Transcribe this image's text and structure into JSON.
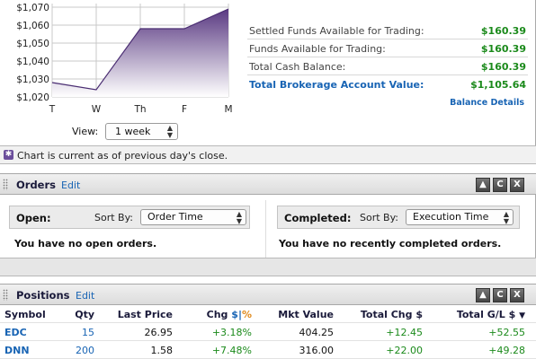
{
  "chart": {
    "y_ticks": [
      "$1,070",
      "$1,060",
      "$1,050",
      "$1,040",
      "$1,030",
      "$1,020"
    ],
    "x_ticks": [
      "T",
      "W",
      "Th",
      "F",
      "M"
    ],
    "view_label": "View:",
    "view_selected": "1 week",
    "fill_top_color": "#5a3a82",
    "fill_bottom_color": "#ffffff"
  },
  "chart_data": {
    "type": "area",
    "categories": [
      "T",
      "W",
      "Th",
      "F",
      "M"
    ],
    "values": [
      1028,
      1024,
      1058,
      1058,
      1069
    ],
    "ylim": [
      1020,
      1072
    ],
    "grid": true
  },
  "balances": {
    "rows": [
      {
        "label": "Settled Funds Available for Trading:",
        "value": "$160.39"
      },
      {
        "label": "Funds Available for Trading:",
        "value": "$160.39"
      },
      {
        "label": "Total Cash Balance:",
        "value": "$160.39"
      },
      {
        "label": "Total Brokerage Account Value:",
        "value": "$1,105.64"
      }
    ],
    "details_link": "Balance Details"
  },
  "note": {
    "icon": "info-icon",
    "text": "Chart is current as of previous day's close."
  },
  "orders": {
    "title": "Orders",
    "edit": "Edit",
    "open": {
      "title": "Open:",
      "sort_label": "Sort By:",
      "sort_value": "Order Time",
      "message": "You have no open orders."
    },
    "completed": {
      "title": "Completed:",
      "sort_label": "Sort By:",
      "sort_value": "Execution Time",
      "message": "You have no recently completed orders."
    }
  },
  "positions": {
    "title": "Positions",
    "edit": "Edit",
    "columns": {
      "symbol": "Symbol",
      "qty": "Qty",
      "last": "Last Price",
      "chg": "Chg",
      "chg_dollar": "$",
      "chg_sep": "|",
      "chg_pct": "%",
      "mkt": "Mkt Value",
      "tchg": "Total Chg $",
      "tgl": "Total G/L $",
      "tgl_arrow": "▼"
    },
    "rows": [
      {
        "symbol": "EDC",
        "qty": "15",
        "last": "26.95",
        "chg": "+3.18%",
        "mkt": "404.25",
        "tchg": "+12.45",
        "tgl": "+52.55"
      },
      {
        "symbol": "DNN",
        "qty": "200",
        "last": "1.58",
        "chg": "+7.48%",
        "mkt": "316.00",
        "tchg": "+22.00",
        "tgl": "+49.28"
      }
    ]
  },
  "controls": {
    "up": "▲",
    "refresh": "C",
    "close": "X"
  }
}
